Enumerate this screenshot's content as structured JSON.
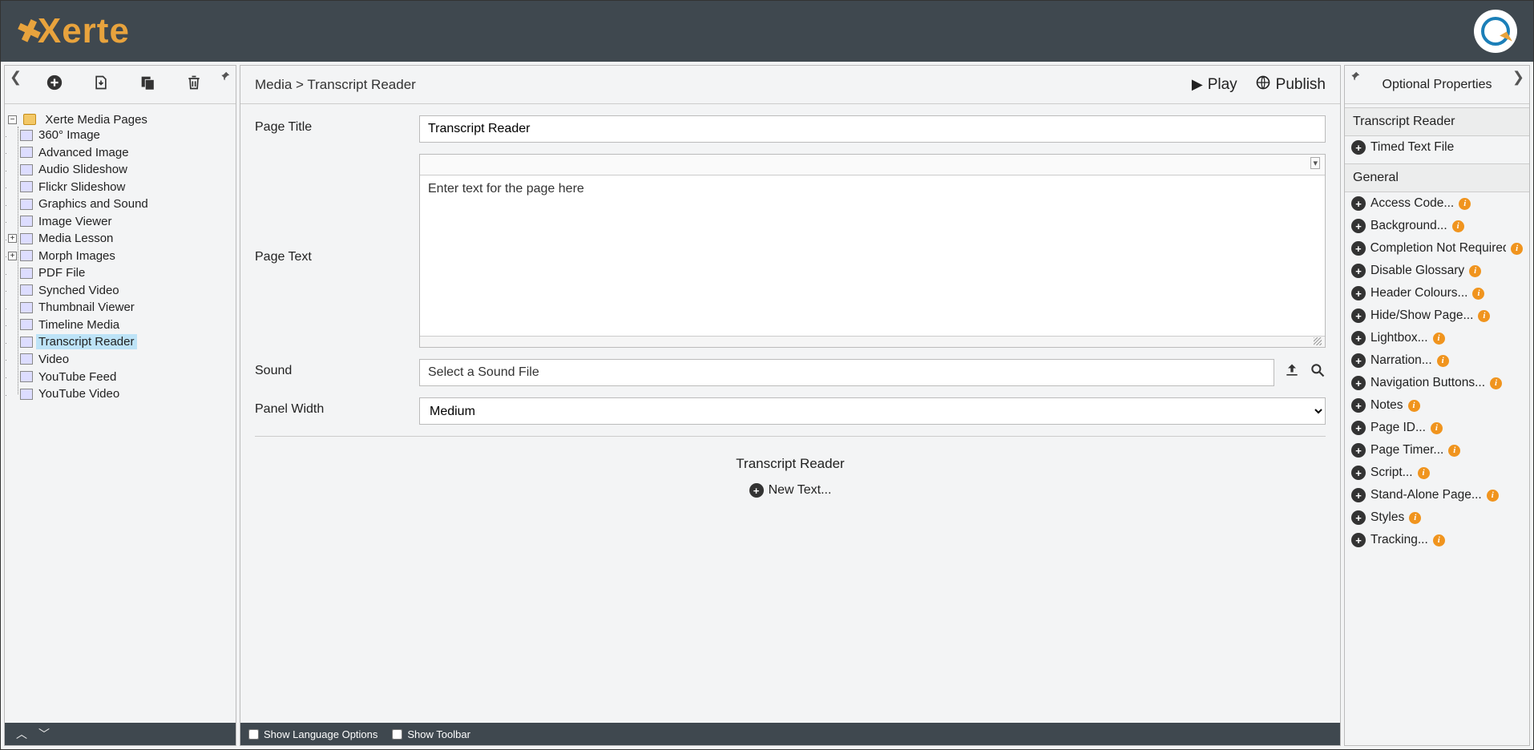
{
  "header": {
    "logo_text": "Xerte"
  },
  "left": {
    "root_label": "Xerte Media Pages",
    "items": [
      {
        "label": "360° Image"
      },
      {
        "label": "Advanced Image"
      },
      {
        "label": "Audio Slideshow"
      },
      {
        "label": "Flickr Slideshow"
      },
      {
        "label": "Graphics and Sound"
      },
      {
        "label": "Image Viewer"
      },
      {
        "label": "Media Lesson",
        "expandable": true
      },
      {
        "label": "Morph Images",
        "expandable": true
      },
      {
        "label": "PDF File"
      },
      {
        "label": "Synched Video"
      },
      {
        "label": "Thumbnail Viewer"
      },
      {
        "label": "Timeline Media"
      },
      {
        "label": "Transcript Reader",
        "selected": true
      },
      {
        "label": "Video"
      },
      {
        "label": "YouTube Feed"
      },
      {
        "label": "YouTube Video"
      }
    ]
  },
  "center": {
    "breadcrumb_parent": "Media",
    "breadcrumb_sep": " > ",
    "breadcrumb_current": "Transcript Reader",
    "play_label": "Play",
    "publish_label": "Publish",
    "fields": {
      "page_title_label": "Page Title",
      "page_title_value": "Transcript Reader",
      "page_text_label": "Page Text",
      "page_text_placeholder": "Enter text for the page here",
      "sound_label": "Sound",
      "sound_placeholder": "Select a Sound File",
      "panel_width_label": "Panel Width",
      "panel_width_value": "Medium"
    },
    "sub": {
      "title": "Transcript Reader",
      "add_label": "New Text..."
    },
    "footer": {
      "lang_label": "Show Language Options",
      "toolbar_label": "Show Toolbar"
    }
  },
  "right": {
    "title": "Optional Properties",
    "group1_header": "Transcript Reader",
    "group1_items": [
      {
        "label": "Timed Text File",
        "info": false
      }
    ],
    "group2_header": "General",
    "group2_items": [
      {
        "label": "Access Code...",
        "info": true
      },
      {
        "label": "Background...",
        "info": true
      },
      {
        "label": "Completion Not Required",
        "info": true,
        "truncated": true
      },
      {
        "label": "Disable Glossary",
        "info": true
      },
      {
        "label": "Header Colours...",
        "info": true
      },
      {
        "label": "Hide/Show Page...",
        "info": true
      },
      {
        "label": "Lightbox...",
        "info": true
      },
      {
        "label": "Narration...",
        "info": true
      },
      {
        "label": "Navigation Buttons...",
        "info": true
      },
      {
        "label": "Notes",
        "info": true
      },
      {
        "label": "Page ID...",
        "info": true
      },
      {
        "label": "Page Timer...",
        "info": true
      },
      {
        "label": "Script...",
        "info": true
      },
      {
        "label": "Stand-Alone Page...",
        "info": true
      },
      {
        "label": "Styles",
        "info": true
      },
      {
        "label": "Tracking...",
        "info": true
      }
    ]
  }
}
